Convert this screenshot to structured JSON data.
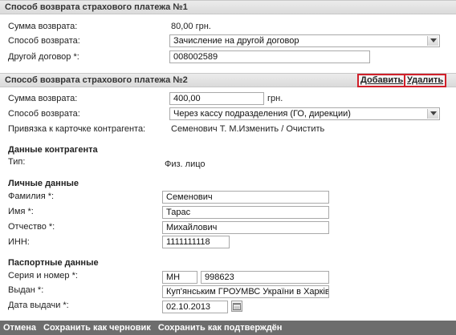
{
  "section1": {
    "title": "Способ возврата страхового платежа №1",
    "sum_label": "Сумма возврата:",
    "sum_value": "80,00 грн.",
    "method_label": "Способ возврата:",
    "method_value": "Зачисление на другой договор",
    "other_contract_label": "Другой договор *:",
    "other_contract_value": "008002589"
  },
  "section2": {
    "title": "Способ возврата страхового платежа №2",
    "add_button": "Добавить",
    "delete_button": "Удалить",
    "sum_label": "Сумма возврата:",
    "sum_value": "400,00",
    "sum_unit": "грн.",
    "method_label": "Способ возврата:",
    "method_value": "Через кассу подразделения (ГО, дирекции)",
    "binding_label": "Привязка к карточке контрагента:",
    "binding_name": "Семенович Т. М.",
    "binding_change": "Изменить",
    "binding_sep": " / ",
    "binding_clear": "Очистить"
  },
  "counterparty": {
    "heading": "Данные контрагента",
    "type_label": "Тип:",
    "type_value": "Физ. лицо"
  },
  "personal": {
    "heading": "Личные данные",
    "surname_label": "Фамилия *:",
    "surname_value": "Семенович",
    "name_label": "Имя *:",
    "name_value": "Тарас",
    "patronymic_label": "Отчество *:",
    "patronymic_value": "Михайлович",
    "inn_label": "ИНН:",
    "inn_value": "1111111118"
  },
  "passport": {
    "heading": "Паспортные данные",
    "series_label": "Серия и номер *:",
    "series_value": "МН",
    "number_value": "998623",
    "issued_label": "Выдан *:",
    "issued_value": "Куп'янським ГРОУМВС України в Харківській",
    "date_label": "Дата выдачи *:",
    "date_value": "02.10.2013"
  },
  "footer": {
    "cancel": "Отмена",
    "save_draft": "Сохранить как черновик",
    "save_confirmed": "Сохранить как подтверждён"
  },
  "icons": {
    "dropdown": "chevron-down-icon",
    "calendar": "calendar-icon"
  },
  "colors": {
    "highlight_border": "#d0202a",
    "footer_bg": "#6d6d6d"
  }
}
